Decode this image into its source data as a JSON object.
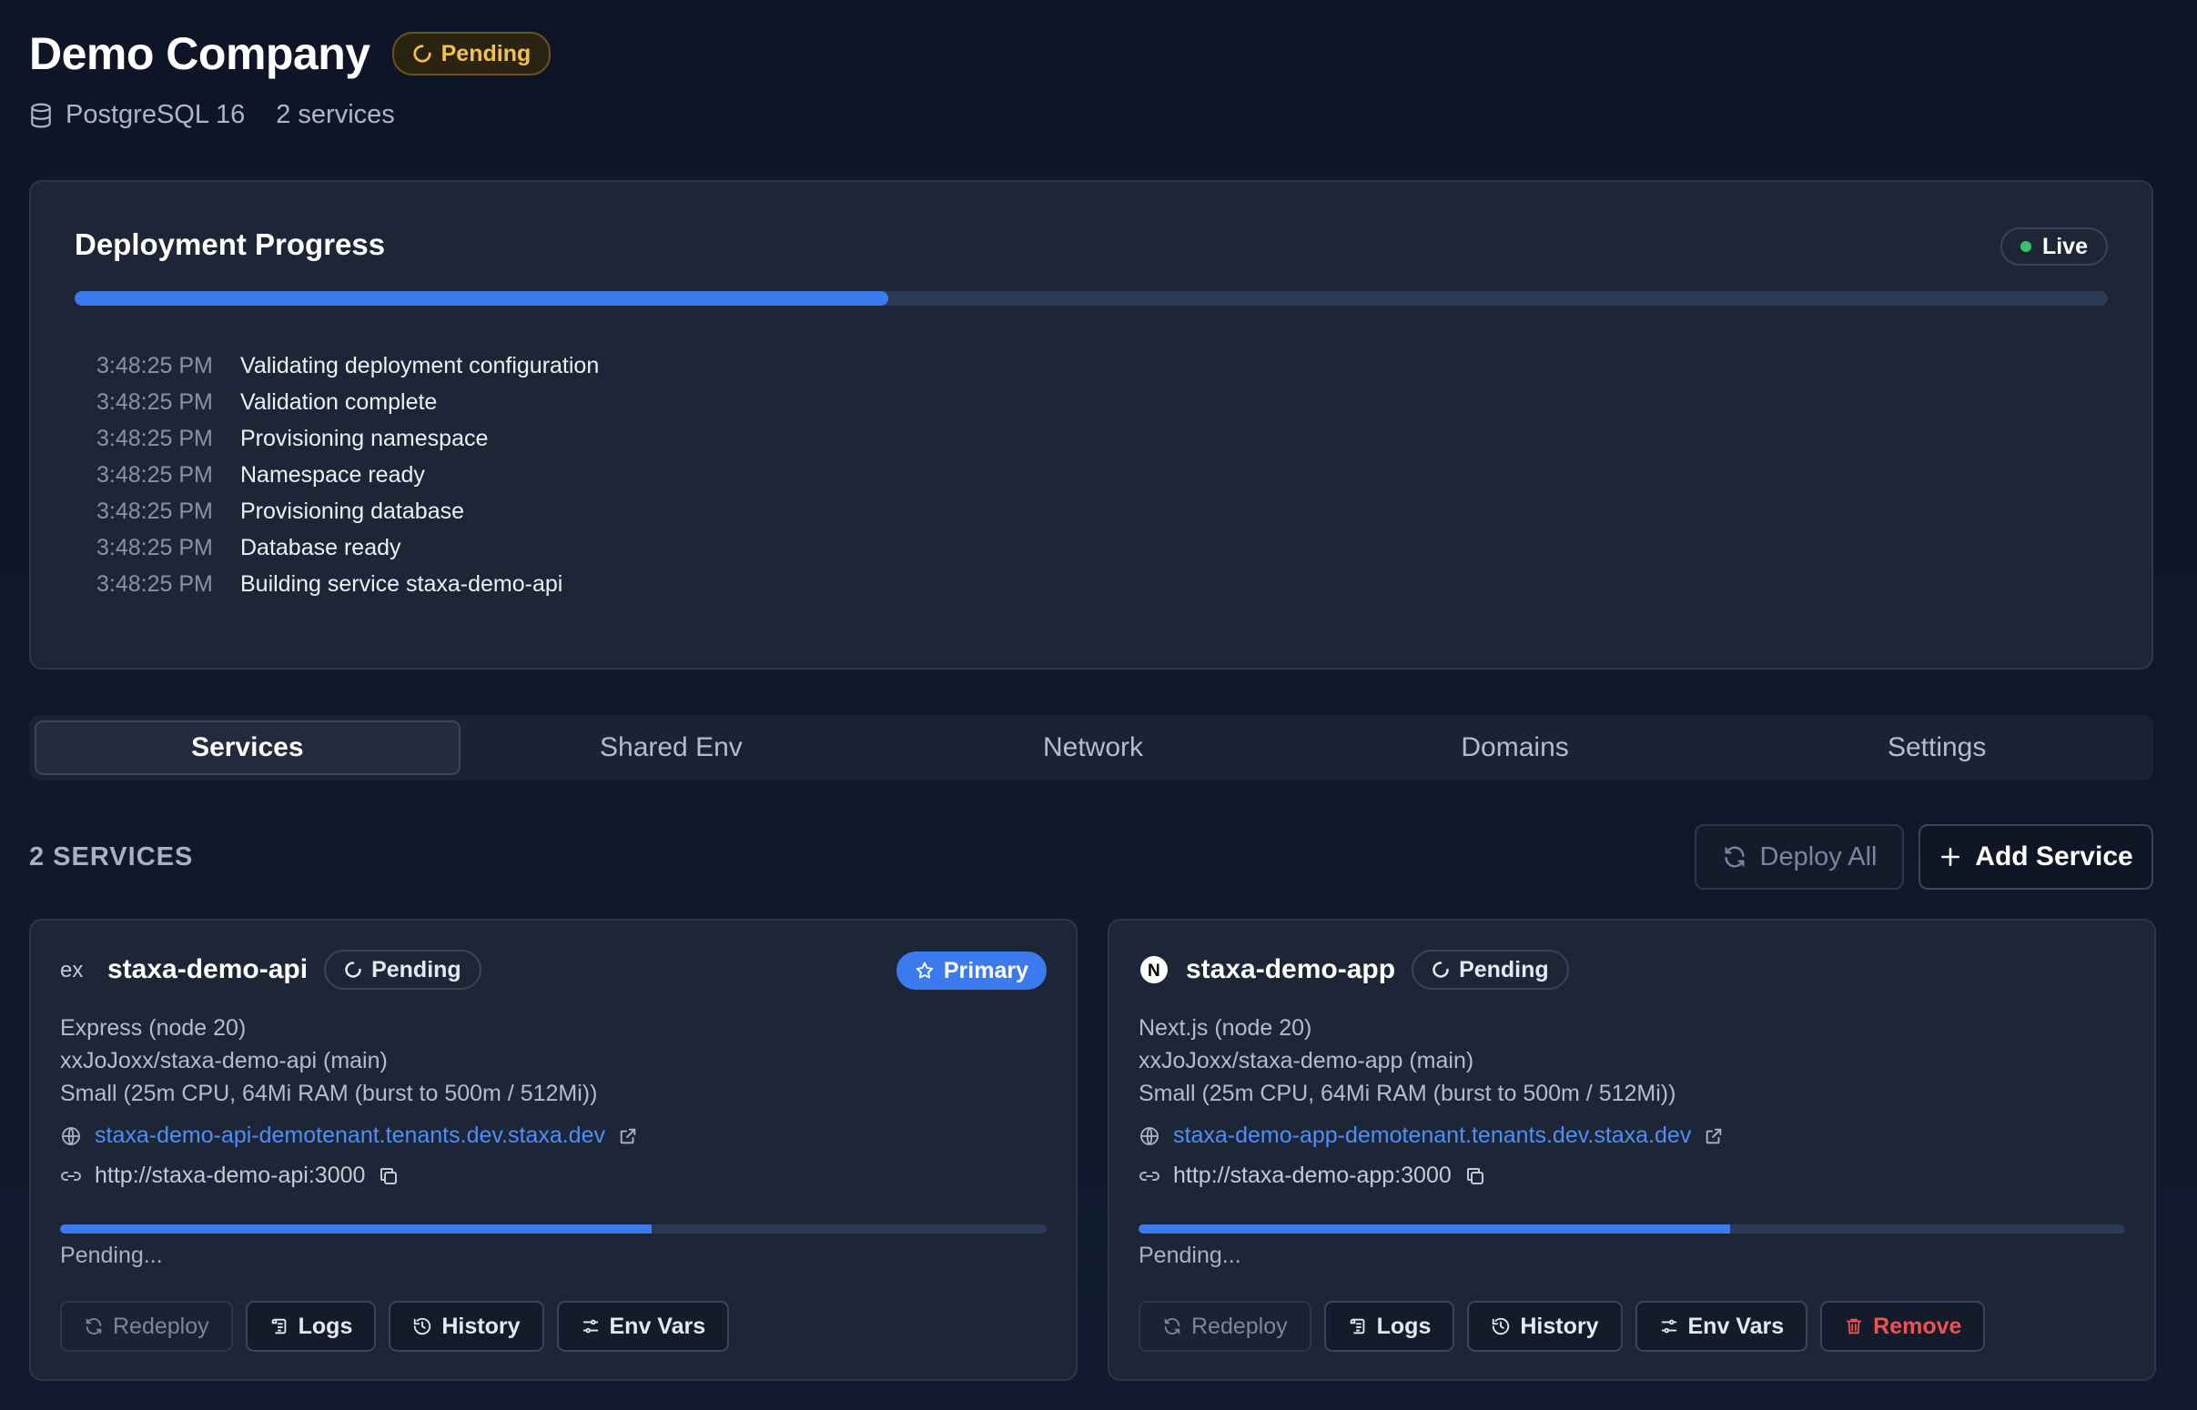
{
  "header": {
    "title": "Demo Company",
    "status": "Pending",
    "database": "PostgreSQL 16",
    "services_count": "2 services"
  },
  "deployment": {
    "title": "Deployment Progress",
    "live_label": "Live",
    "progress": 0.4,
    "log": [
      {
        "time": "3:48:25 PM",
        "message": "Validating deployment configuration"
      },
      {
        "time": "3:48:25 PM",
        "message": "Validation complete"
      },
      {
        "time": "3:48:25 PM",
        "message": "Provisioning namespace"
      },
      {
        "time": "3:48:25 PM",
        "message": "Namespace ready"
      },
      {
        "time": "3:48:25 PM",
        "message": "Provisioning database"
      },
      {
        "time": "3:48:25 PM",
        "message": "Database ready"
      },
      {
        "time": "3:48:25 PM",
        "message": "Building service staxa-demo-api"
      }
    ]
  },
  "tabs": [
    {
      "label": "Services",
      "active": true
    },
    {
      "label": "Shared Env"
    },
    {
      "label": "Network"
    },
    {
      "label": "Domains"
    },
    {
      "label": "Settings"
    }
  ],
  "services_section": {
    "heading": "2 SERVICES",
    "deploy_all_label": "Deploy All",
    "add_service_label": "Add Service"
  },
  "services": [
    {
      "name": "staxa-demo-api",
      "logo": "express-icon",
      "status": "Pending",
      "primary_label": "Primary",
      "framework": "Express (node 20)",
      "repo": "xxJoJoxx/staxa-demo-api (main)",
      "size": "Small (25m CPU, 64Mi RAM (burst to 500m / 512Mi))",
      "public_url": "staxa-demo-api-demotenant.tenants.dev.staxa.dev",
      "internal_url": "http://staxa-demo-api:3000",
      "progress": 0.6,
      "progress_label": "Pending...",
      "actions": {
        "redeploy": "Redeploy",
        "logs": "Logs",
        "history": "History",
        "env": "Env Vars"
      }
    },
    {
      "name": "staxa-demo-app",
      "logo": "nextjs-icon",
      "status": "Pending",
      "framework": "Next.js (node 20)",
      "repo": "xxJoJoxx/staxa-demo-app (main)",
      "size": "Small (25m CPU, 64Mi RAM (burst to 500m / 512Mi))",
      "public_url": "staxa-demo-app-demotenant.tenants.dev.staxa.dev",
      "internal_url": "http://staxa-demo-app:3000",
      "progress": 0.6,
      "progress_label": "Pending...",
      "actions": {
        "redeploy": "Redeploy",
        "logs": "Logs",
        "history": "History",
        "env": "Env Vars",
        "remove": "Remove"
      }
    }
  ],
  "colors": {
    "accent": "#3b7bef",
    "pending": "#f2c14e",
    "live": "#36c46a",
    "danger": "#f05252"
  }
}
